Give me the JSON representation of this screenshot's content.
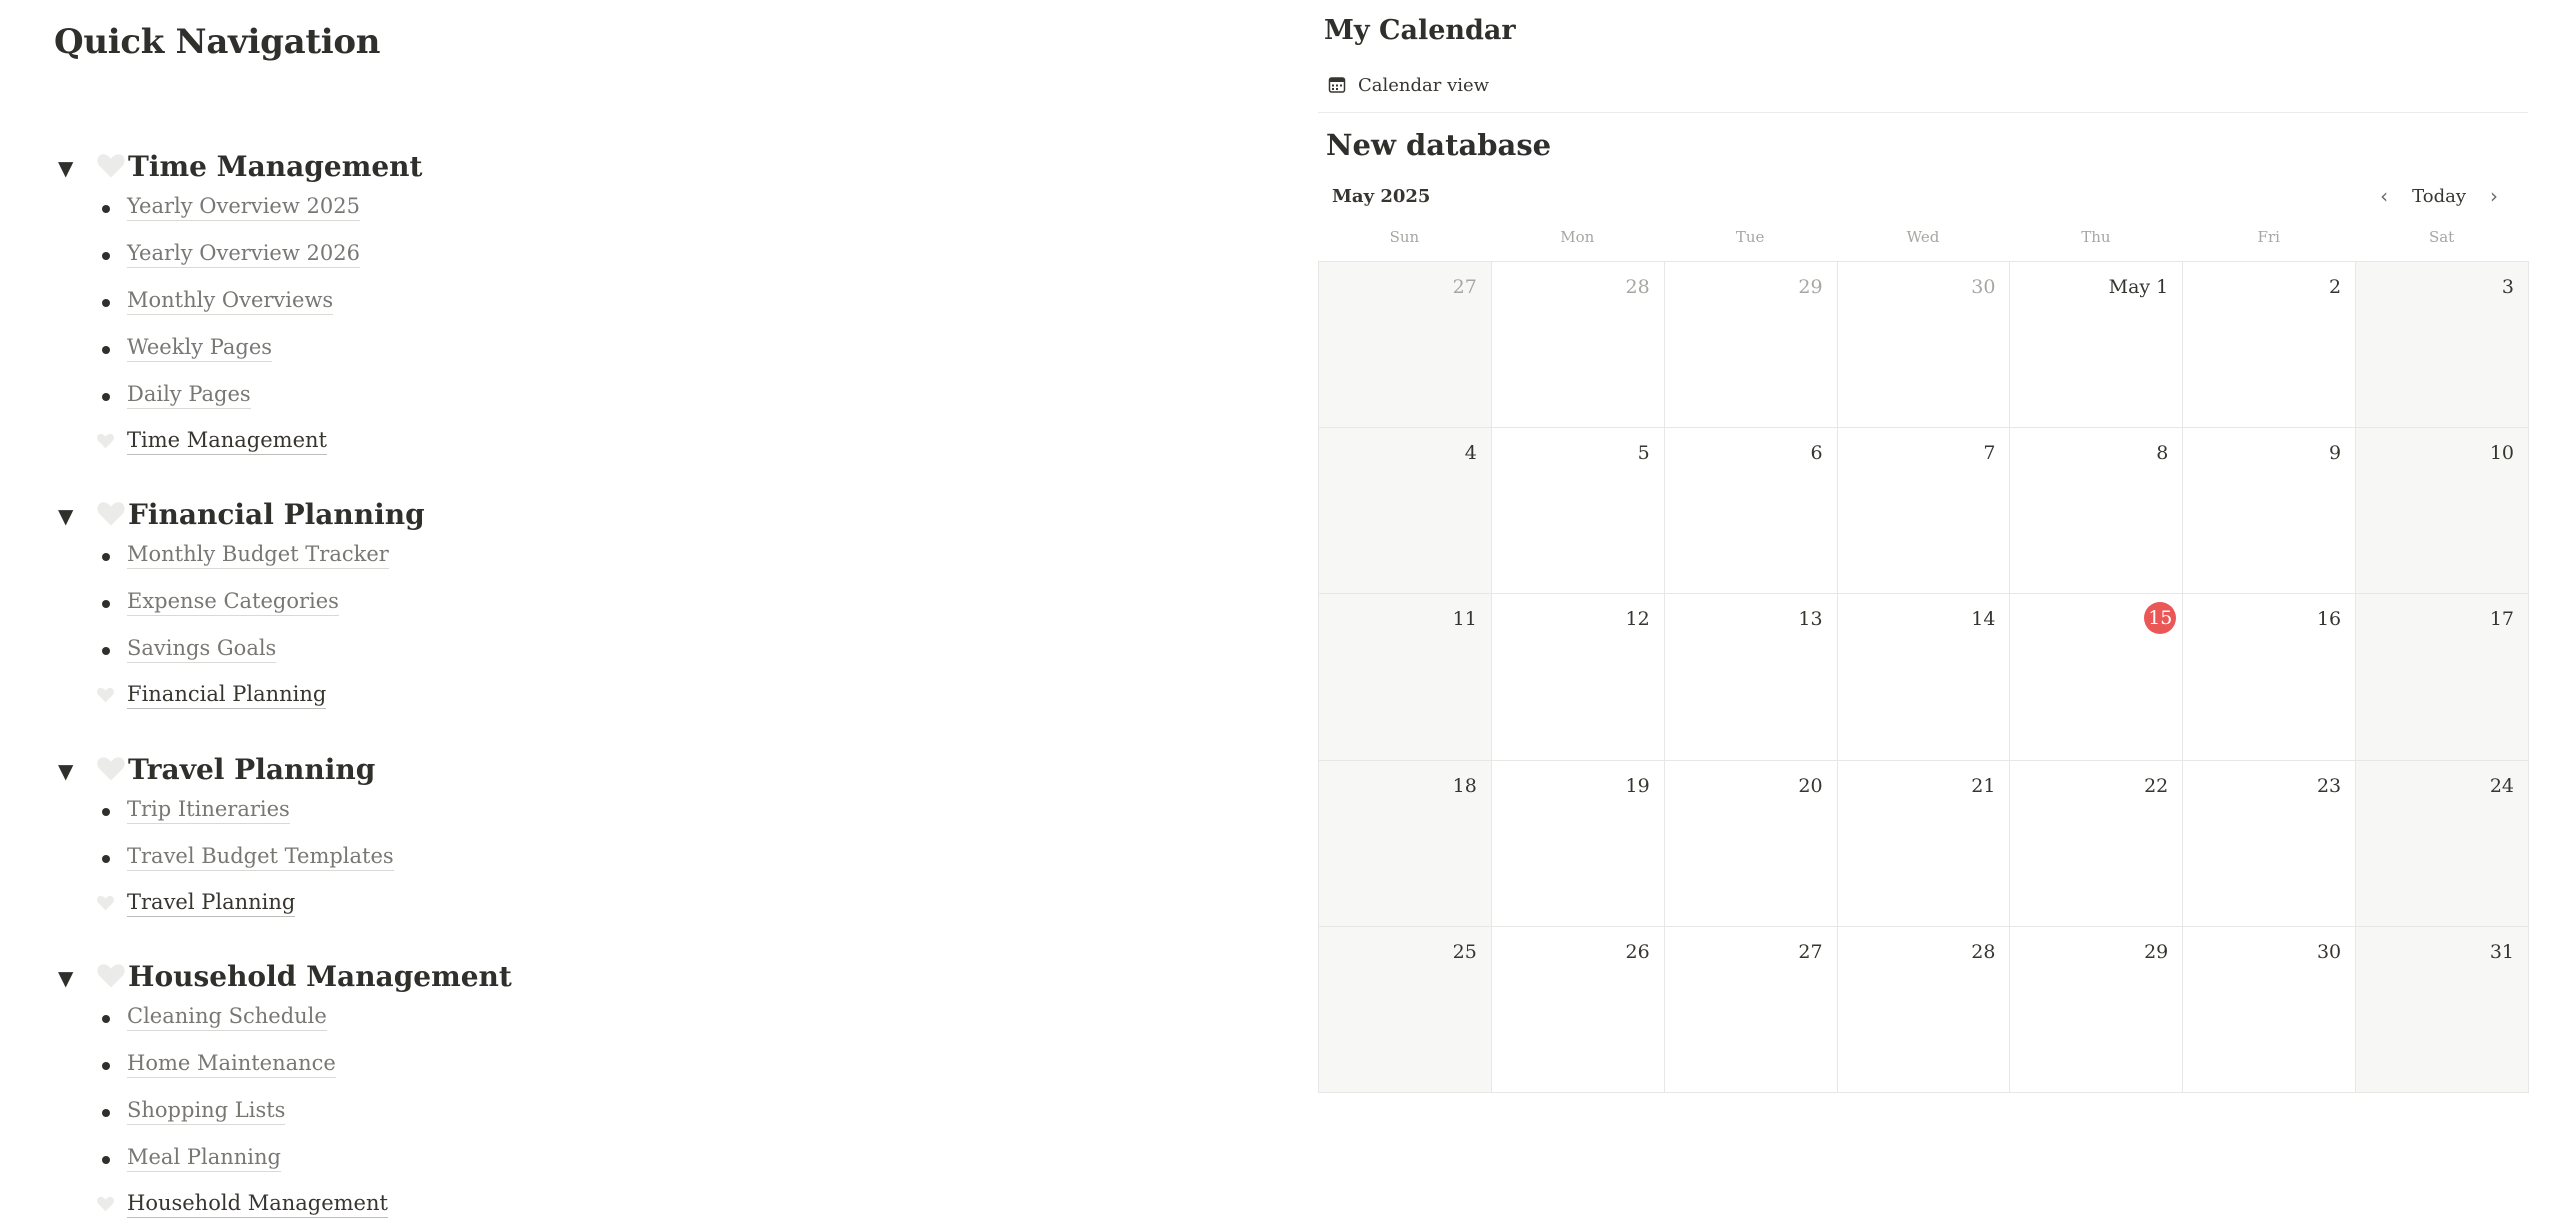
{
  "nav": {
    "title": "Quick Navigation",
    "sections": [
      {
        "title": "Time Management",
        "links": [
          "Yearly Overview 2025",
          "Yearly Overview 2026",
          "Monthly Overviews",
          "Weekly Pages",
          "Daily Pages"
        ],
        "page_link": "Time Management"
      },
      {
        "title": "Financial Planning",
        "links": [
          "Monthly Budget Tracker",
          "Expense Categories",
          "Savings Goals"
        ],
        "page_link": "Financial Planning"
      },
      {
        "title": "Travel Planning",
        "links": [
          "Trip Itineraries",
          "Travel Budget Templates"
        ],
        "page_link": "Travel Planning"
      },
      {
        "title": "Household Management",
        "links": [
          "Cleaning Schedule",
          "Home Maintenance",
          "Shopping Lists",
          "Meal Planning"
        ],
        "page_link": "Household Management"
      }
    ]
  },
  "calendar": {
    "title": "My Calendar",
    "view_tab": "Calendar view",
    "database_title": "New database",
    "month_label": "May 2025",
    "today_button": "Today",
    "weekdays": [
      "Sun",
      "Mon",
      "Tue",
      "Wed",
      "Thu",
      "Fri",
      "Sat"
    ],
    "days": [
      "27",
      "28",
      "29",
      "30",
      "May 1",
      "2",
      "3",
      "4",
      "5",
      "6",
      "7",
      "8",
      "9",
      "10",
      "11",
      "12",
      "13",
      "14",
      "15",
      "16",
      "17",
      "18",
      "19",
      "20",
      "21",
      "22",
      "23",
      "24",
      "25",
      "26",
      "27",
      "28",
      "29",
      "30",
      "31"
    ],
    "muted_day_indices": [
      0,
      1,
      2,
      3
    ],
    "today_index": 18,
    "today_color": "#eb5757"
  }
}
